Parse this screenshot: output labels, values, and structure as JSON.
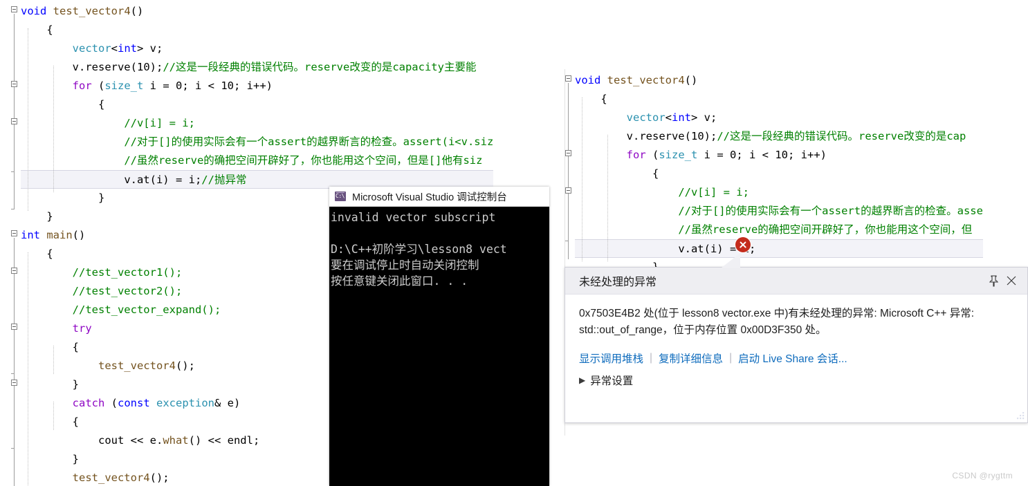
{
  "left_editor": {
    "name": "source-code-editor-left",
    "lines": [
      {
        "indent": 0,
        "segments": [
          {
            "t": "void ",
            "c": "kw"
          },
          {
            "t": "test_vector4",
            "c": "fn"
          },
          {
            "t": "()",
            "c": "plain"
          }
        ]
      },
      {
        "indent": 1,
        "segments": [
          {
            "t": "{",
            "c": "plain"
          }
        ]
      },
      {
        "indent": 2,
        "segments": [
          {
            "t": "vector",
            "c": "type"
          },
          {
            "t": "<",
            "c": "plain"
          },
          {
            "t": "int",
            "c": "kw"
          },
          {
            "t": "> v;",
            "c": "plain"
          }
        ]
      },
      {
        "indent": 2,
        "segments": [
          {
            "t": "v.reserve(",
            "c": "plain"
          },
          {
            "t": "10",
            "c": "num"
          },
          {
            "t": ");",
            "c": "plain"
          },
          {
            "t": "//这是一段经典的错误代码。reserve改变的是capacity主要能",
            "c": "cmt"
          }
        ]
      },
      {
        "indent": 2,
        "segments": [
          {
            "t": "for ",
            "c": "kwctl"
          },
          {
            "t": "(",
            "c": "plain"
          },
          {
            "t": "size_t",
            "c": "type"
          },
          {
            "t": " i = ",
            "c": "plain"
          },
          {
            "t": "0",
            "c": "num"
          },
          {
            "t": "; i < ",
            "c": "plain"
          },
          {
            "t": "10",
            "c": "num"
          },
          {
            "t": "; i++)",
            "c": "plain"
          }
        ]
      },
      {
        "indent": 3,
        "segments": [
          {
            "t": "{",
            "c": "plain"
          }
        ]
      },
      {
        "indent": 4,
        "segments": [
          {
            "t": "//v[i] = i;",
            "c": "cmt"
          }
        ]
      },
      {
        "indent": 4,
        "segments": [
          {
            "t": "//对于[]的使用实际会有一个assert的越界断言的检查。assert(i<v.siz",
            "c": "cmt"
          }
        ]
      },
      {
        "indent": 4,
        "segments": [
          {
            "t": "//虽然reserve的确把空间开辟好了，你也能用这个空间，但是[]他有siz",
            "c": "cmt"
          }
        ]
      },
      {
        "indent": 4,
        "current": true,
        "segments": [
          {
            "t": "v.at(i) = i;",
            "c": "plain"
          },
          {
            "t": "//抛异常",
            "c": "cmt"
          }
        ]
      },
      {
        "indent": 3,
        "segments": [
          {
            "t": "}",
            "c": "plain"
          }
        ]
      },
      {
        "indent": 1,
        "segments": [
          {
            "t": "}",
            "c": "plain"
          }
        ]
      },
      {
        "indent": 0,
        "segments": [
          {
            "t": "int ",
            "c": "kw"
          },
          {
            "t": "main",
            "c": "fn"
          },
          {
            "t": "()",
            "c": "plain"
          }
        ]
      },
      {
        "indent": 1,
        "segments": [
          {
            "t": "{",
            "c": "plain"
          }
        ]
      },
      {
        "indent": 2,
        "segments": [
          {
            "t": "//test_vector1();",
            "c": "cmt"
          }
        ]
      },
      {
        "indent": 2,
        "segments": [
          {
            "t": "//test_vector2();",
            "c": "cmt"
          }
        ]
      },
      {
        "indent": 2,
        "segments": [
          {
            "t": "//test_vector_expand();",
            "c": "cmt"
          }
        ]
      },
      {
        "indent": 2,
        "segments": [
          {
            "t": "try",
            "c": "kwctl"
          }
        ]
      },
      {
        "indent": 2,
        "segments": [
          {
            "t": "{",
            "c": "plain"
          }
        ]
      },
      {
        "indent": 3,
        "segments": [
          {
            "t": "test_vector4",
            "c": "fn"
          },
          {
            "t": "();",
            "c": "plain"
          }
        ]
      },
      {
        "indent": 2,
        "segments": [
          {
            "t": "}",
            "c": "plain"
          }
        ]
      },
      {
        "indent": 2,
        "segments": [
          {
            "t": "catch ",
            "c": "kwctl"
          },
          {
            "t": "(",
            "c": "plain"
          },
          {
            "t": "const ",
            "c": "kw"
          },
          {
            "t": "exception",
            "c": "type"
          },
          {
            "t": "& e)",
            "c": "plain"
          }
        ]
      },
      {
        "indent": 2,
        "segments": [
          {
            "t": "{",
            "c": "plain"
          }
        ]
      },
      {
        "indent": 3,
        "segments": [
          {
            "t": "cout << e.",
            "c": "plain"
          },
          {
            "t": "what",
            "c": "fn"
          },
          {
            "t": "() << endl;",
            "c": "plain"
          }
        ]
      },
      {
        "indent": 2,
        "segments": [
          {
            "t": "}",
            "c": "plain"
          }
        ]
      },
      {
        "indent": 2,
        "segments": [
          {
            "t": "test_vector4",
            "c": "fn"
          },
          {
            "t": "();",
            "c": "plain"
          }
        ]
      }
    ]
  },
  "right_editor": {
    "name": "source-code-editor-right",
    "lines": [
      {
        "indent": 0,
        "segments": [
          {
            "t": "void ",
            "c": "kw"
          },
          {
            "t": "test_vector4",
            "c": "fn"
          },
          {
            "t": "()",
            "c": "plain"
          }
        ]
      },
      {
        "indent": 1,
        "segments": [
          {
            "t": "{",
            "c": "plain"
          }
        ]
      },
      {
        "indent": 2,
        "segments": [
          {
            "t": "vector",
            "c": "type"
          },
          {
            "t": "<",
            "c": "plain"
          },
          {
            "t": "int",
            "c": "kw"
          },
          {
            "t": "> v;",
            "c": "plain"
          }
        ]
      },
      {
        "indent": 2,
        "segments": [
          {
            "t": "v.reserve(",
            "c": "plain"
          },
          {
            "t": "10",
            "c": "num"
          },
          {
            "t": ");",
            "c": "plain"
          },
          {
            "t": "//这是一段经典的错误代码。reserve改变的是cap",
            "c": "cmt"
          }
        ]
      },
      {
        "indent": 2,
        "segments": [
          {
            "t": "for ",
            "c": "kwctl"
          },
          {
            "t": "(",
            "c": "plain"
          },
          {
            "t": "size_t",
            "c": "type"
          },
          {
            "t": " i = ",
            "c": "plain"
          },
          {
            "t": "0",
            "c": "num"
          },
          {
            "t": "; i < ",
            "c": "plain"
          },
          {
            "t": "10",
            "c": "num"
          },
          {
            "t": "; i++)",
            "c": "plain"
          }
        ]
      },
      {
        "indent": 3,
        "segments": [
          {
            "t": "{",
            "c": "plain"
          }
        ]
      },
      {
        "indent": 4,
        "segments": [
          {
            "t": "//v[i] = i;",
            "c": "cmt"
          }
        ]
      },
      {
        "indent": 4,
        "segments": [
          {
            "t": "//对于[]的使用实际会有一个assert的越界断言的检查。asse",
            "c": "cmt"
          }
        ]
      },
      {
        "indent": 4,
        "segments": [
          {
            "t": "//虽然reserve的确把空间开辟好了，你也能用这个空间，但",
            "c": "cmt"
          }
        ]
      },
      {
        "indent": 4,
        "current": true,
        "segments": [
          {
            "t": "v.at(i) = i;",
            "c": "plain"
          }
        ]
      },
      {
        "indent": 3,
        "segments": [
          {
            "t": "}",
            "c": "plain"
          }
        ]
      }
    ]
  },
  "console_window": {
    "title": "Microsoft Visual Studio 调试控制台",
    "icon": "console-icon",
    "lines": [
      "invalid vector subscript",
      "",
      "D:\\C++初阶学习\\lesson8 vect",
      "要在调试停止时自动关闭控制",
      "按任意键关闭此窗口. . ."
    ]
  },
  "exception_dialog": {
    "title": "未经处理的异常",
    "pin_icon": "pin-icon",
    "close_icon": "close-icon",
    "message": "0x7503E4B2 处(位于 lesson8 vector.exe 中)有未经处理的异常: Microsoft C++ 异常: std::out_of_range，位于内存位置 0x00D3F350 处。",
    "links": [
      "显示调用堆栈",
      "复制详细信息",
      "启动 Live Share 会话..."
    ],
    "link_separator": "|",
    "settings_label": "异常设置",
    "disclosure_glyph": "▶",
    "error_icon": "error-circle-icon"
  },
  "watermark": "CSDN @rygttm",
  "colors": {
    "keyword": "#0000ff",
    "control_keyword": "#8f08c4",
    "type": "#2b91af",
    "function": "#74531f",
    "comment": "#008000",
    "link": "#0f6cbd",
    "error": "#c42b1c",
    "dialog_header_bg": "#eeeef2",
    "console_bg": "#000000",
    "console_fg": "#cccccc",
    "current_line_bg": "#f3f3f8"
  }
}
